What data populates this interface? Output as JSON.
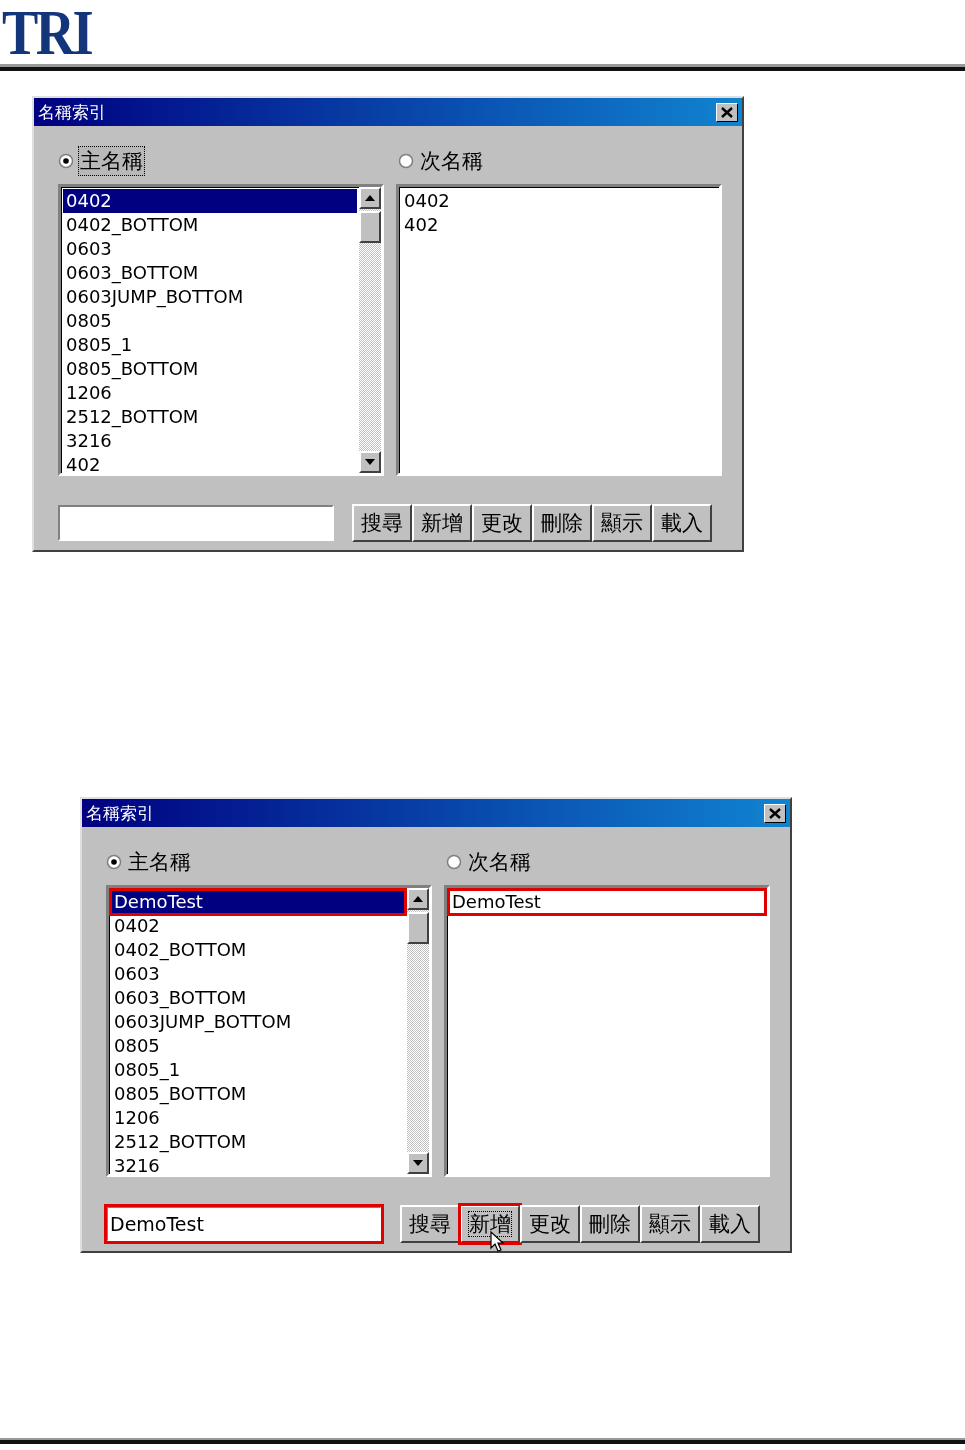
{
  "header": {
    "logo": "TRI"
  },
  "dialogs": [
    {
      "title": "名稱索引",
      "radios": [
        {
          "label": "主名稱",
          "selected": true,
          "focused": true
        },
        {
          "label": "次名稱",
          "selected": false,
          "focused": false
        }
      ],
      "primary_list": {
        "items": [
          {
            "text": "0402",
            "selected": true,
            "highlighted": false
          },
          {
            "text": "0402_BOTTOM",
            "selected": false,
            "highlighted": false
          },
          {
            "text": "0603",
            "selected": false,
            "highlighted": false
          },
          {
            "text": "0603_BOTTOM",
            "selected": false,
            "highlighted": false
          },
          {
            "text": "0603JUMP_BOTTOM",
            "selected": false,
            "highlighted": false
          },
          {
            "text": "0805",
            "selected": false,
            "highlighted": false
          },
          {
            "text": "0805_1",
            "selected": false,
            "highlighted": false
          },
          {
            "text": "0805_BOTTOM",
            "selected": false,
            "highlighted": false
          },
          {
            "text": "1206",
            "selected": false,
            "highlighted": false
          },
          {
            "text": "2512_BOTTOM",
            "selected": false,
            "highlighted": false
          },
          {
            "text": "3216",
            "selected": false,
            "highlighted": false
          },
          {
            "text": "402",
            "selected": false,
            "highlighted": false
          }
        ]
      },
      "secondary_list": {
        "items": [
          {
            "text": "0402",
            "highlighted": false
          },
          {
            "text": "402",
            "highlighted": false
          }
        ]
      },
      "search_field": {
        "highlighted": false
      },
      "buttons": [
        {
          "label": "搜尋",
          "focused": false,
          "highlighted": false,
          "pointer": false
        },
        {
          "label": "新增",
          "focused": false,
          "highlighted": false,
          "pointer": false
        },
        {
          "label": "更改",
          "focused": false,
          "highlighted": false,
          "pointer": false
        },
        {
          "label": "刪除",
          "focused": false,
          "highlighted": false,
          "pointer": false
        },
        {
          "label": "顯示",
          "focused": false,
          "highlighted": false,
          "pointer": false
        },
        {
          "label": "載入",
          "focused": false,
          "highlighted": false,
          "pointer": false
        }
      ]
    },
    {
      "title": "名稱索引",
      "radios": [
        {
          "label": "主名稱",
          "selected": true,
          "focused": false
        },
        {
          "label": "次名稱",
          "selected": false,
          "focused": false
        }
      ],
      "primary_list": {
        "items": [
          {
            "text": "DemoTest",
            "selected": true,
            "highlighted": true
          },
          {
            "text": "0402",
            "selected": false,
            "highlighted": false
          },
          {
            "text": "0402_BOTTOM",
            "selected": false,
            "highlighted": false
          },
          {
            "text": "0603",
            "selected": false,
            "highlighted": false
          },
          {
            "text": "0603_BOTTOM",
            "selected": false,
            "highlighted": false
          },
          {
            "text": "0603JUMP_BOTTOM",
            "selected": false,
            "highlighted": false
          },
          {
            "text": "0805",
            "selected": false,
            "highlighted": false
          },
          {
            "text": "0805_1",
            "selected": false,
            "highlighted": false
          },
          {
            "text": "0805_BOTTOM",
            "selected": false,
            "highlighted": false
          },
          {
            "text": "1206",
            "selected": false,
            "highlighted": false
          },
          {
            "text": "2512_BOTTOM",
            "selected": false,
            "highlighted": false
          },
          {
            "text": "3216",
            "selected": false,
            "highlighted": false
          }
        ]
      },
      "secondary_list": {
        "items": [
          {
            "text": "DemoTest",
            "highlighted": true
          }
        ]
      },
      "search_field": {
        "value": "DemoTest",
        "highlighted": true
      },
      "buttons": [
        {
          "label": "搜尋",
          "focused": false,
          "highlighted": false,
          "pointer": false
        },
        {
          "label": "新增",
          "focused": true,
          "highlighted": true,
          "pointer": true
        },
        {
          "label": "更改",
          "focused": false,
          "highlighted": false,
          "pointer": false
        },
        {
          "label": "刪除",
          "focused": false,
          "highlighted": false,
          "pointer": false
        },
        {
          "label": "顯示",
          "focused": false,
          "highlighted": false,
          "pointer": false
        },
        {
          "label": "載入",
          "focused": false,
          "highlighted": false,
          "pointer": false
        }
      ]
    }
  ]
}
